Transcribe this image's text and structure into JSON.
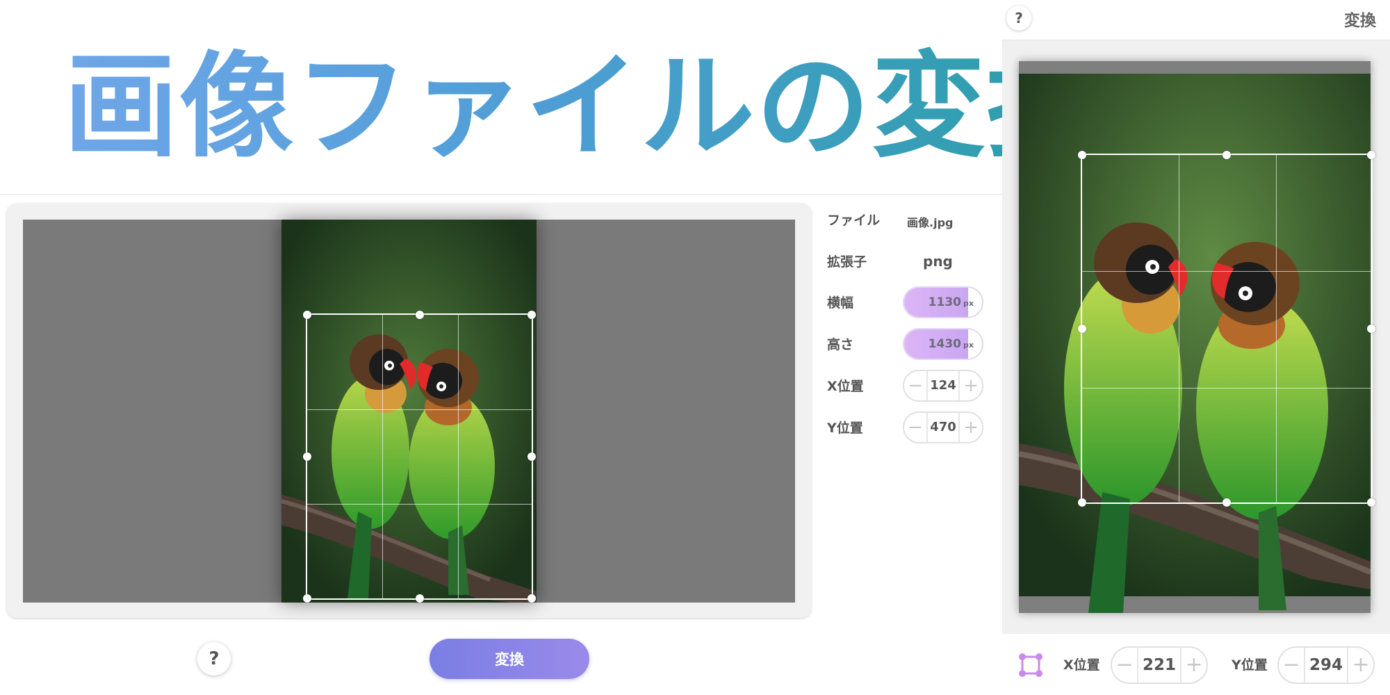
{
  "banner": {
    "title": "画像ファイルの変換"
  },
  "editor": {
    "image_alt": "lovebirds-photo"
  },
  "properties": {
    "file": {
      "label": "ファイル",
      "value": "画像.jpg"
    },
    "extension": {
      "label": "拡張子",
      "value": "png"
    },
    "width": {
      "label": "横幅",
      "value": "1130",
      "unit": "px",
      "fill_fraction": 0.82
    },
    "height": {
      "label": "高さ",
      "value": "1430",
      "unit": "px",
      "fill_fraction": 0.82
    },
    "x": {
      "label": "X位置",
      "value": "124",
      "minus": "−",
      "plus": "+"
    },
    "y": {
      "label": "Y位置",
      "value": "470",
      "minus": "−",
      "plus": "+"
    }
  },
  "actions": {
    "help": "?",
    "convert": "変換"
  },
  "preview": {
    "help": "?",
    "title": "変換",
    "x": {
      "label": "X位置",
      "value": "221",
      "minus": "−",
      "plus": "+"
    },
    "y": {
      "label": "Y位置",
      "value": "294",
      "minus": "−",
      "plus": "+"
    }
  },
  "colors": {
    "accent": "#8a86e6",
    "slider": "#d4aef4",
    "icon": "#c98be9"
  },
  "icons": [
    "help-icon",
    "crop-icon",
    "minus-icon",
    "plus-icon"
  ]
}
